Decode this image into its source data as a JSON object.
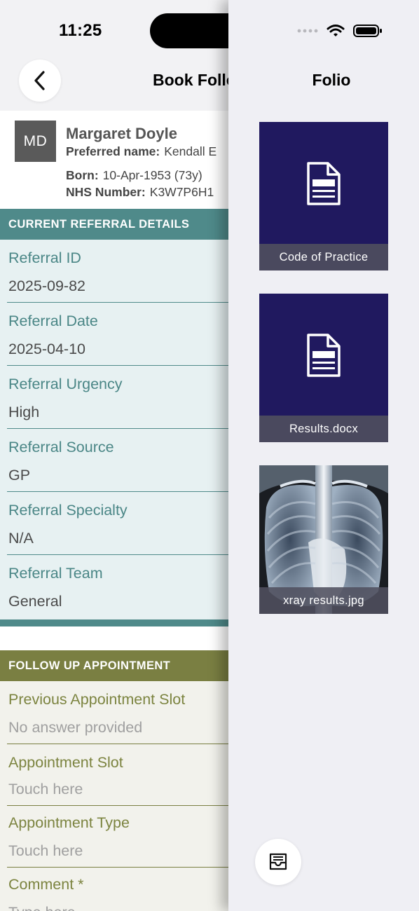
{
  "status_bar": {
    "time": "11:25"
  },
  "nav": {
    "title": "Book Follo"
  },
  "patient": {
    "initials": "MD",
    "name": "Margaret Doyle",
    "preferred_label": "Preferred name:",
    "preferred_value": "Kendall E",
    "born_label": "Born:",
    "born_value": "10-Apr-1953 (73y)",
    "nhs_label": "NHS Number:",
    "nhs_value": "K3W7P6H1"
  },
  "referral": {
    "header": "CURRENT REFERRAL DETAILS",
    "fields": [
      {
        "label": "Referral ID",
        "value": "2025-09-82"
      },
      {
        "label": "Referral Date",
        "value": "2025-04-10"
      },
      {
        "label": "Referral Urgency",
        "value": "High"
      },
      {
        "label": "Referral Source",
        "value": "GP"
      },
      {
        "label": "Referral Specialty",
        "value": "N/A"
      },
      {
        "label": "Referral Team",
        "value": "General"
      }
    ]
  },
  "follow_up": {
    "header": "FOLLOW UP APPOINTMENT",
    "fields": [
      {
        "label": "Previous Appointment Slot",
        "value": "No answer provided"
      },
      {
        "label": "Appointment Slot",
        "value": "Touch here"
      },
      {
        "label": "Appointment Type",
        "value": "Touch here"
      },
      {
        "label": "Comment *",
        "value": "Type here"
      }
    ]
  },
  "folio": {
    "title": "Folio",
    "documents": [
      {
        "name": "Code of Practice",
        "icon": "document-icon"
      },
      {
        "name": "Results.docx",
        "icon": "document-icon"
      },
      {
        "name": "xray results.jpg",
        "icon": "xray-image"
      }
    ]
  },
  "colors": {
    "referral_accent": "#4f8a8a",
    "referral_bg": "#e7f1f2",
    "follow_accent": "#7a7f42",
    "follow_bg": "#f2f2ec",
    "tile_bg": "#20195f",
    "panel_bg": "#efeff4"
  }
}
